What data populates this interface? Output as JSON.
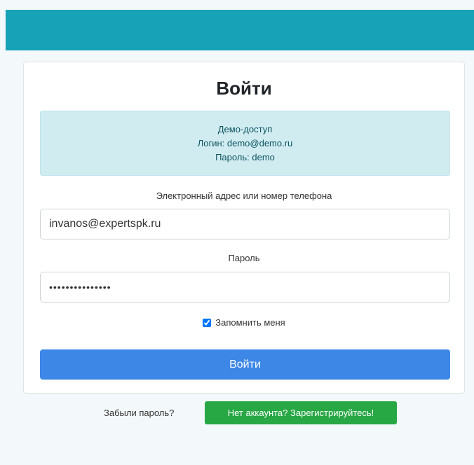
{
  "header": {
    "color": "#17a2b8"
  },
  "login": {
    "title": "Войти",
    "demo": {
      "heading": "Демо-доступ",
      "login_line": "Логин: demo@demo.ru",
      "password_line": "Пароль: demo"
    },
    "email_label": "Электронный адрес или номер телефона",
    "email_value": "invanos@expertspk.ru",
    "password_label": "Пароль",
    "password_value": "•••••••••••••••",
    "remember_label": "Запомнить меня",
    "remember_checked": true,
    "submit_label": "Войти",
    "submit_color": "#3d87e7"
  },
  "footer": {
    "forgot_label": "Забыли пароль?",
    "register_label": "Нет аккаунта? Зарегистрируйтесь!",
    "register_color": "#28a745"
  }
}
